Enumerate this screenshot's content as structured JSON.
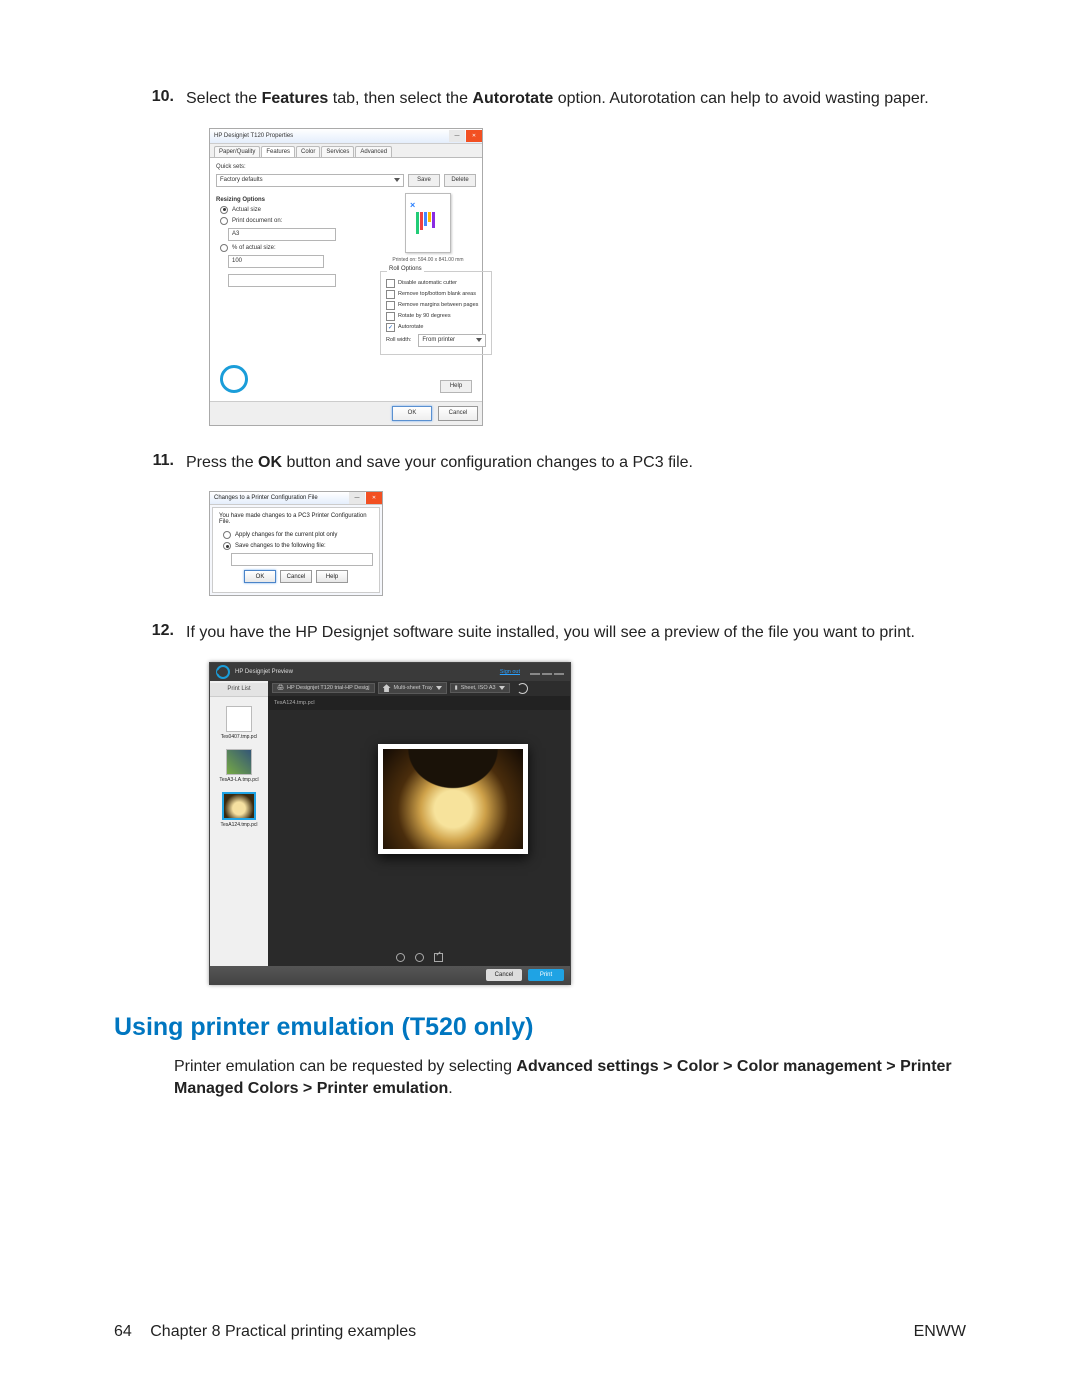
{
  "step10": {
    "num": "10.",
    "pre": "Select the ",
    "b1": "Features",
    "mid": " tab, then select the ",
    "b2": "Autorotate",
    "post": " option. Autorotation can help to avoid wasting paper."
  },
  "dlg1": {
    "title": "HP Designjet T120 Properties",
    "tabs": [
      "Paper/Quality",
      "Features",
      "Color",
      "Services",
      "Advanced"
    ],
    "quicksets_label": "Quick sets:",
    "quicksets_value": "Factory defaults",
    "save": "Save",
    "delete": "Delete",
    "resizing_label": "Resizing Options",
    "r_actual": "Actual size",
    "r_printdoc": "Print document on:",
    "printdoc_value": "A3",
    "r_pct": "% of actual size:",
    "pct_value": "100",
    "preview_size": "Printed on: 594.00 x 841.00 mm",
    "roll_label": "Roll Options",
    "roll_opts": [
      "Disable automatic cutter",
      "Remove top/bottom blank areas",
      "Remove margins between pages",
      "Rotate by 90 degrees",
      "Autorotate"
    ],
    "rollwidth_label": "Roll width:",
    "rollwidth_value": "From printer",
    "help": "Help",
    "ok": "OK",
    "cancel": "Cancel"
  },
  "step11": {
    "num": "11.",
    "pre": "Press the ",
    "b1": "OK",
    "post": " button and save your configuration changes to a PC3 file."
  },
  "dlg2": {
    "title": "Changes to a Printer Configuration File",
    "msg": "You have made changes to a PC3 Printer Configuration File.",
    "r_apply": "Apply changes for the current plot only",
    "r_save": "Save changes to the following file:",
    "ok": "OK",
    "cancel": "Cancel",
    "help": "Help"
  },
  "step12": {
    "num": "12.",
    "text": "If you have the HP Designjet software suite installed, you will see a preview of the file you want to print."
  },
  "dlg3": {
    "app": "HP Designjet Preview",
    "signout": "Sign out",
    "printlist": "Print List",
    "thumbs": [
      "Tes0407.tmp.pcl",
      "TesA3-LA.tmp.pcl",
      "TesA124.tmp.pcl"
    ],
    "device": "HP Designjet T120 trial-HP Desigj",
    "tray": "Multi-sheet Tray",
    "sheet": "Sheet, ISO A3",
    "filename": "TesA124.tmp.pcl",
    "cancel": "Cancel",
    "print": "Print"
  },
  "heading": "Using printer emulation (T520 only)",
  "emul_pre": "Printer emulation can be requested by selecting ",
  "emul_bold": "Advanced settings > Color > Color management > Printer Managed Colors > Printer emulation",
  "emul_post": ".",
  "footer": {
    "page": "64",
    "chapter": "Chapter 8   Practical printing examples",
    "enww": "ENWW"
  }
}
